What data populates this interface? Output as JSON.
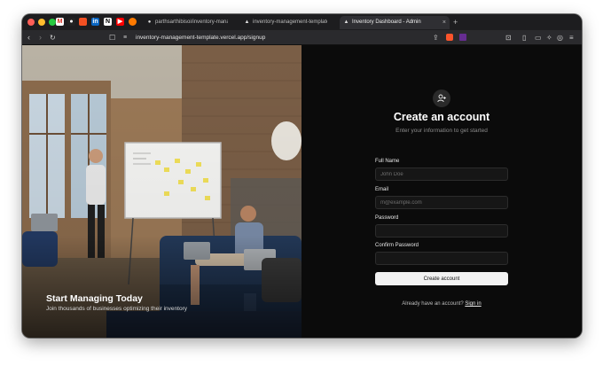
{
  "browser": {
    "tabs": [
      {
        "title": "parthsarthibisoi/inventory-manag...",
        "icon": "github-icon"
      },
      {
        "title": "inventory-management-template",
        "icon": "vercel-icon"
      },
      {
        "title": "Inventory Dashboard - Admin",
        "icon": "vercel-icon"
      }
    ],
    "url": "inventory-management-template.vercel.app/signup"
  },
  "hero": {
    "title": "Start Managing Today",
    "subtitle": "Join thousands of businesses optimizing their inventory"
  },
  "form": {
    "title": "Create an account",
    "subtitle": "Enter your information to get started",
    "full_name_label": "Full Name",
    "full_name_placeholder": "John Doe",
    "email_label": "Email",
    "email_placeholder": "m@example.com",
    "password_label": "Password",
    "confirm_password_label": "Confirm Password",
    "submit_label": "Create account",
    "signin_prompt": "Already have an account?",
    "signin_link": "Sign in"
  }
}
